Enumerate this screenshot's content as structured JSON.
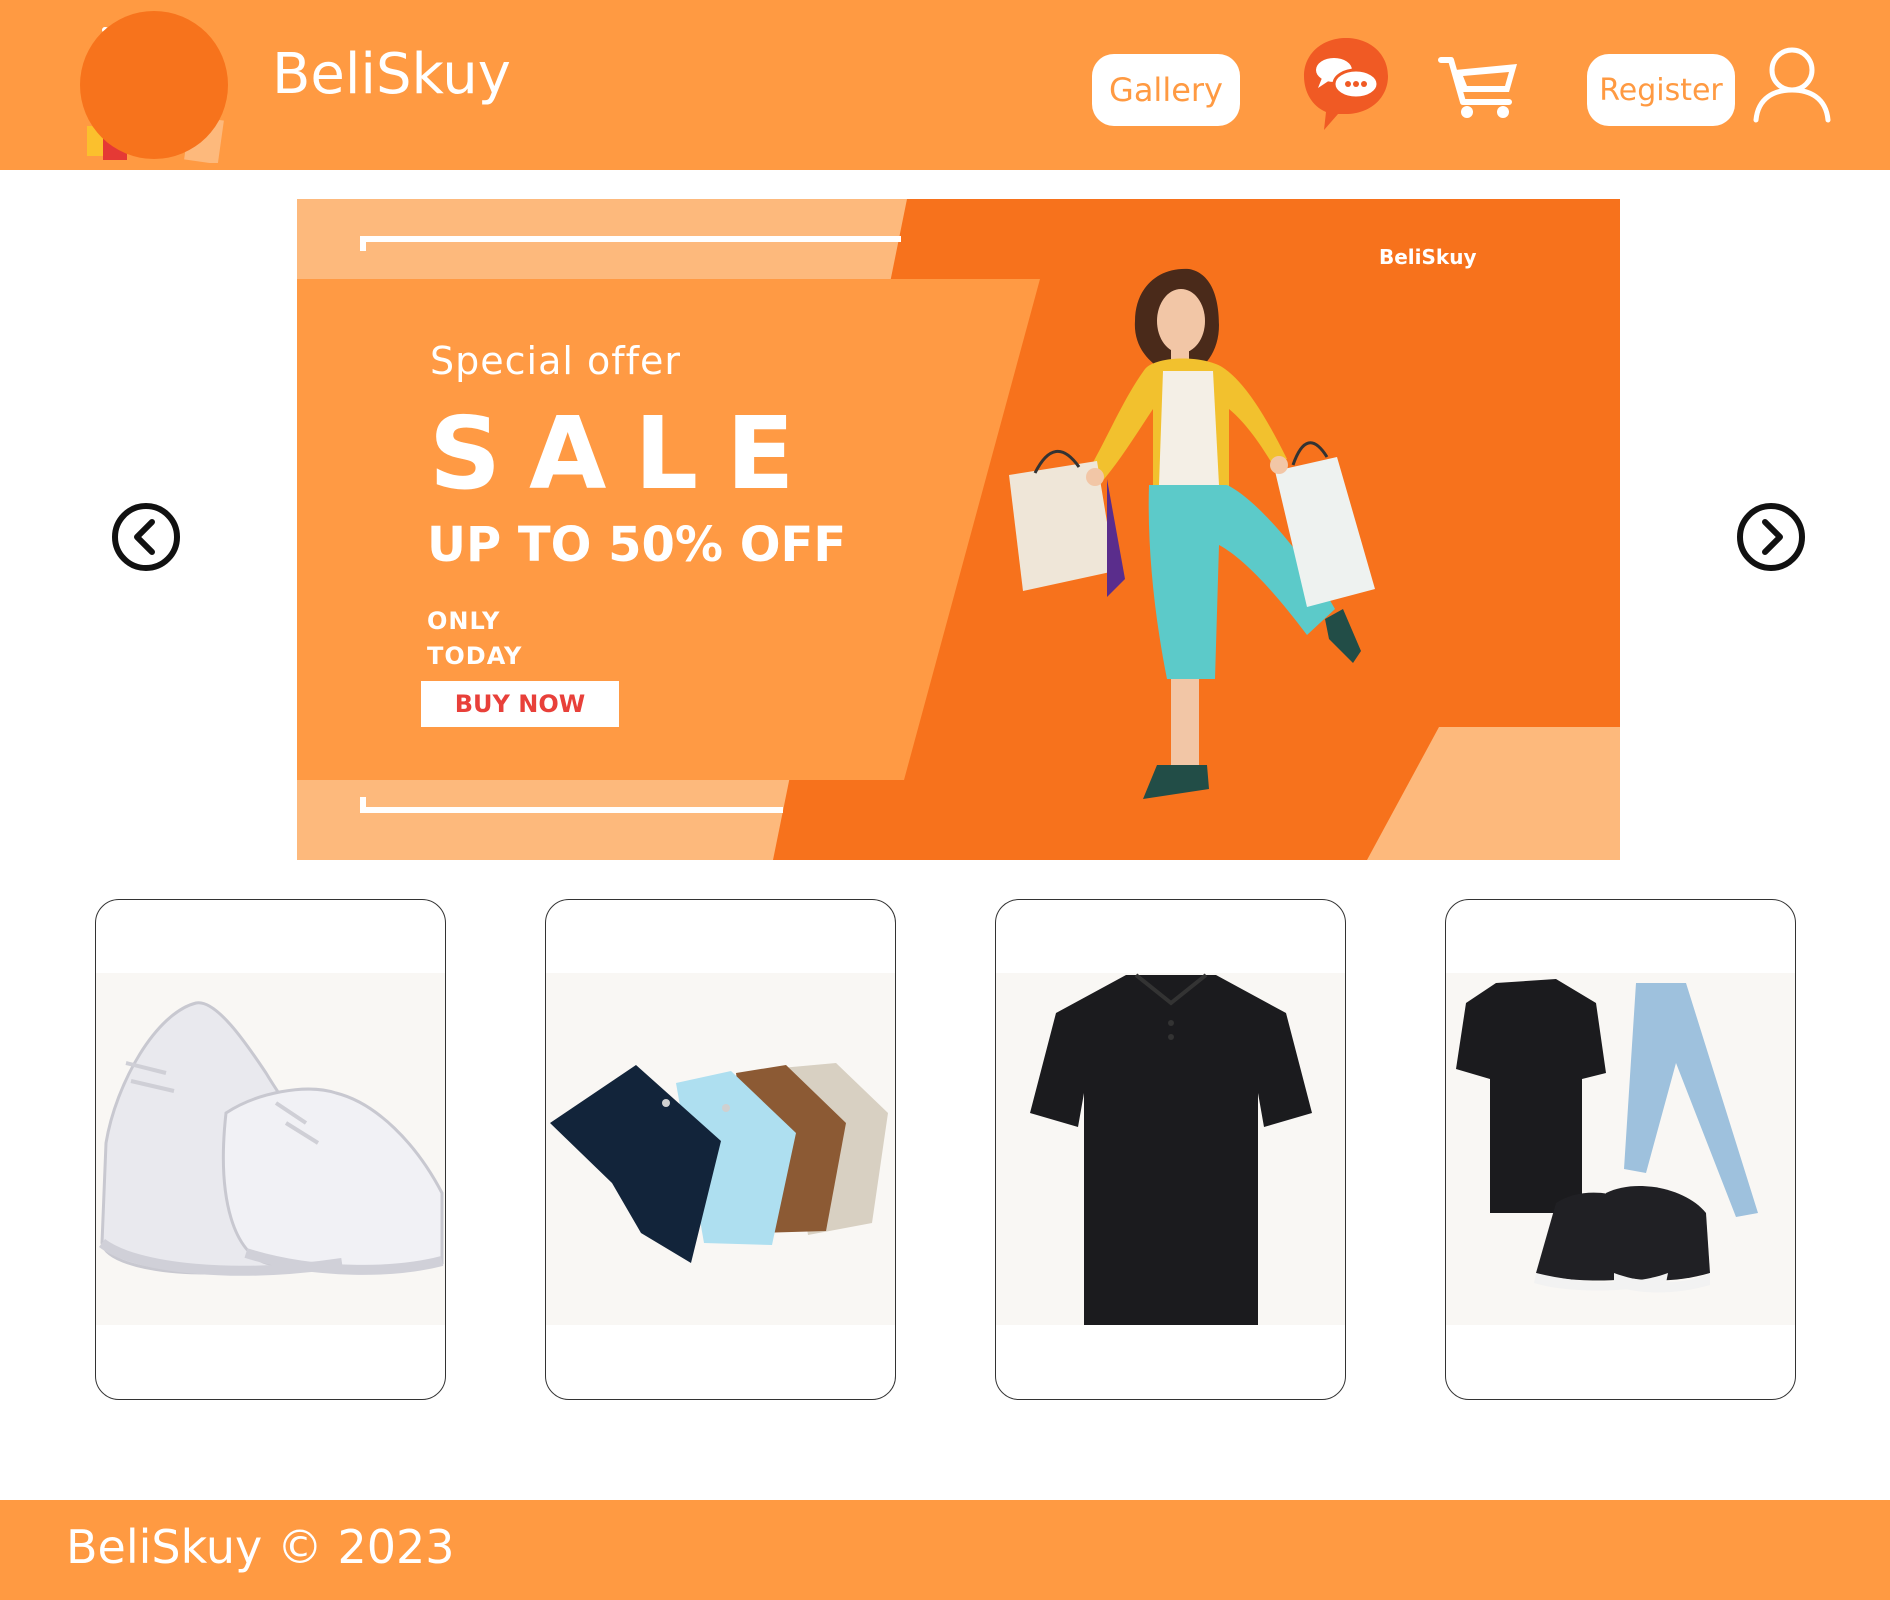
{
  "header": {
    "brand": "BeliSkuy",
    "gallery_label": "Gallery",
    "register_label": "Register",
    "icons": [
      "shopping-cart-logo",
      "chat-icon",
      "cart-icon",
      "user-icon"
    ]
  },
  "banner": {
    "special_offer": "Special offer",
    "sale": "SALE",
    "discount": "UP TO 50% OFF",
    "only_line1": "ONLY",
    "only_line2": "TODAY",
    "buy_now": "BUY NOW",
    "brand": "BeliSkuy"
  },
  "carousel": {
    "prev_icon": "chevron-left-icon",
    "next_icon": "chevron-right-icon"
  },
  "products": [
    {
      "image": "white-sneakers"
    },
    {
      "image": "shorts"
    },
    {
      "image": "black-polo-shirt"
    },
    {
      "image": "outfit-set"
    }
  ],
  "footer": {
    "copyright": "BeliSkuy © 2023"
  },
  "colors": {
    "header_bg": "#ff9a42",
    "banner_dark": "#f7721c",
    "banner_light": "#fdb97c",
    "buy_text": "#e8403a"
  }
}
